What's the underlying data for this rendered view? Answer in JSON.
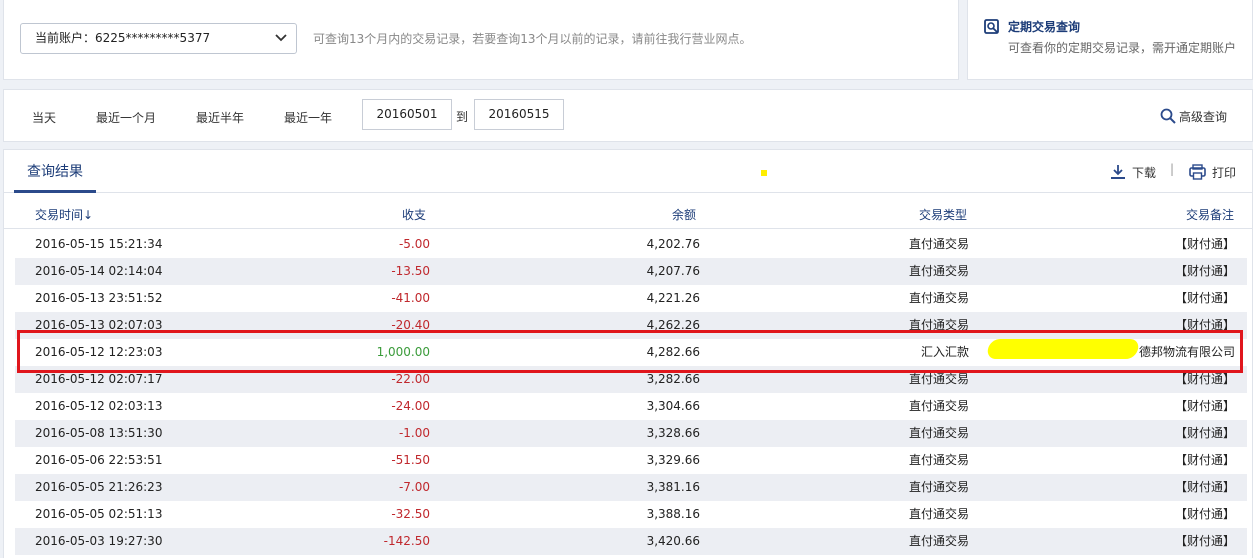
{
  "account": {
    "label": "当前账户：",
    "number": "6225*********5377",
    "hint": "可查询13个月内的交易记录，若要查询13个月以前的记录，请前往我行营业网点。"
  },
  "fixed": {
    "title": "定期交易查询",
    "desc": "可查看你的定期交易记录，需开通定期账户"
  },
  "filter": {
    "quick": [
      "当天",
      "最近一个月",
      "最近半年",
      "最近一年"
    ],
    "from": "20160501",
    "to_label": "到",
    "to": "20160515",
    "advanced": "高级查询"
  },
  "result": {
    "tab": "查询结果",
    "download": "下载",
    "separator": "|",
    "print": "打印"
  },
  "table": {
    "headers": [
      "交易时间",
      "收支",
      "余额",
      "交易类型",
      "交易备注"
    ],
    "sort_arrow": "↓",
    "rows": [
      {
        "time": "2016-05-15  15:21:34",
        "amount": "-5.00",
        "balance": "4,202.76",
        "type": "直付通交易",
        "note": "【财付通】"
      },
      {
        "time": "2016-05-14  02:14:04",
        "amount": "-13.50",
        "balance": "4,207.76",
        "type": "直付通交易",
        "note": "【财付通】"
      },
      {
        "time": "2016-05-13  23:51:52",
        "amount": "-41.00",
        "balance": "4,221.26",
        "type": "直付通交易",
        "note": "【财付通】"
      },
      {
        "time": "2016-05-13  02:07:03",
        "amount": "-20.40",
        "balance": "4,262.26",
        "type": "直付通交易",
        "note": "【财付通】"
      },
      {
        "time": "2016-05-12  12:23:03",
        "amount": "1,000.00",
        "balance": "4,282.66",
        "type": "汇入汇款",
        "note": "德邦物流有限公司"
      },
      {
        "time": "2016-05-12  02:07:17",
        "amount": "-22.00",
        "balance": "3,282.66",
        "type": "直付通交易",
        "note": "【财付通】"
      },
      {
        "time": "2016-05-12  02:03:13",
        "amount": "-24.00",
        "balance": "3,304.66",
        "type": "直付通交易",
        "note": "【财付通】"
      },
      {
        "time": "2016-05-08  13:51:30",
        "amount": "-1.00",
        "balance": "3,328.66",
        "type": "直付通交易",
        "note": "【财付通】"
      },
      {
        "time": "2016-05-06  22:53:51",
        "amount": "-51.50",
        "balance": "3,329.66",
        "type": "直付通交易",
        "note": "【财付通】"
      },
      {
        "time": "2016-05-05  21:26:23",
        "amount": "-7.00",
        "balance": "3,381.16",
        "type": "直付通交易",
        "note": "【财付通】"
      },
      {
        "time": "2016-05-05  02:51:13",
        "amount": "-32.50",
        "balance": "3,388.16",
        "type": "直付通交易",
        "note": "【财付通】"
      },
      {
        "time": "2016-05-03  19:27:30",
        "amount": "-142.50",
        "balance": "3,420.66",
        "type": "直付通交易",
        "note": "【财付通】"
      }
    ]
  },
  "colors": {
    "negative": "#c0282d",
    "positive": "#3a9b3a",
    "accent": "#1c3c78",
    "highlight": "#e0161c"
  }
}
